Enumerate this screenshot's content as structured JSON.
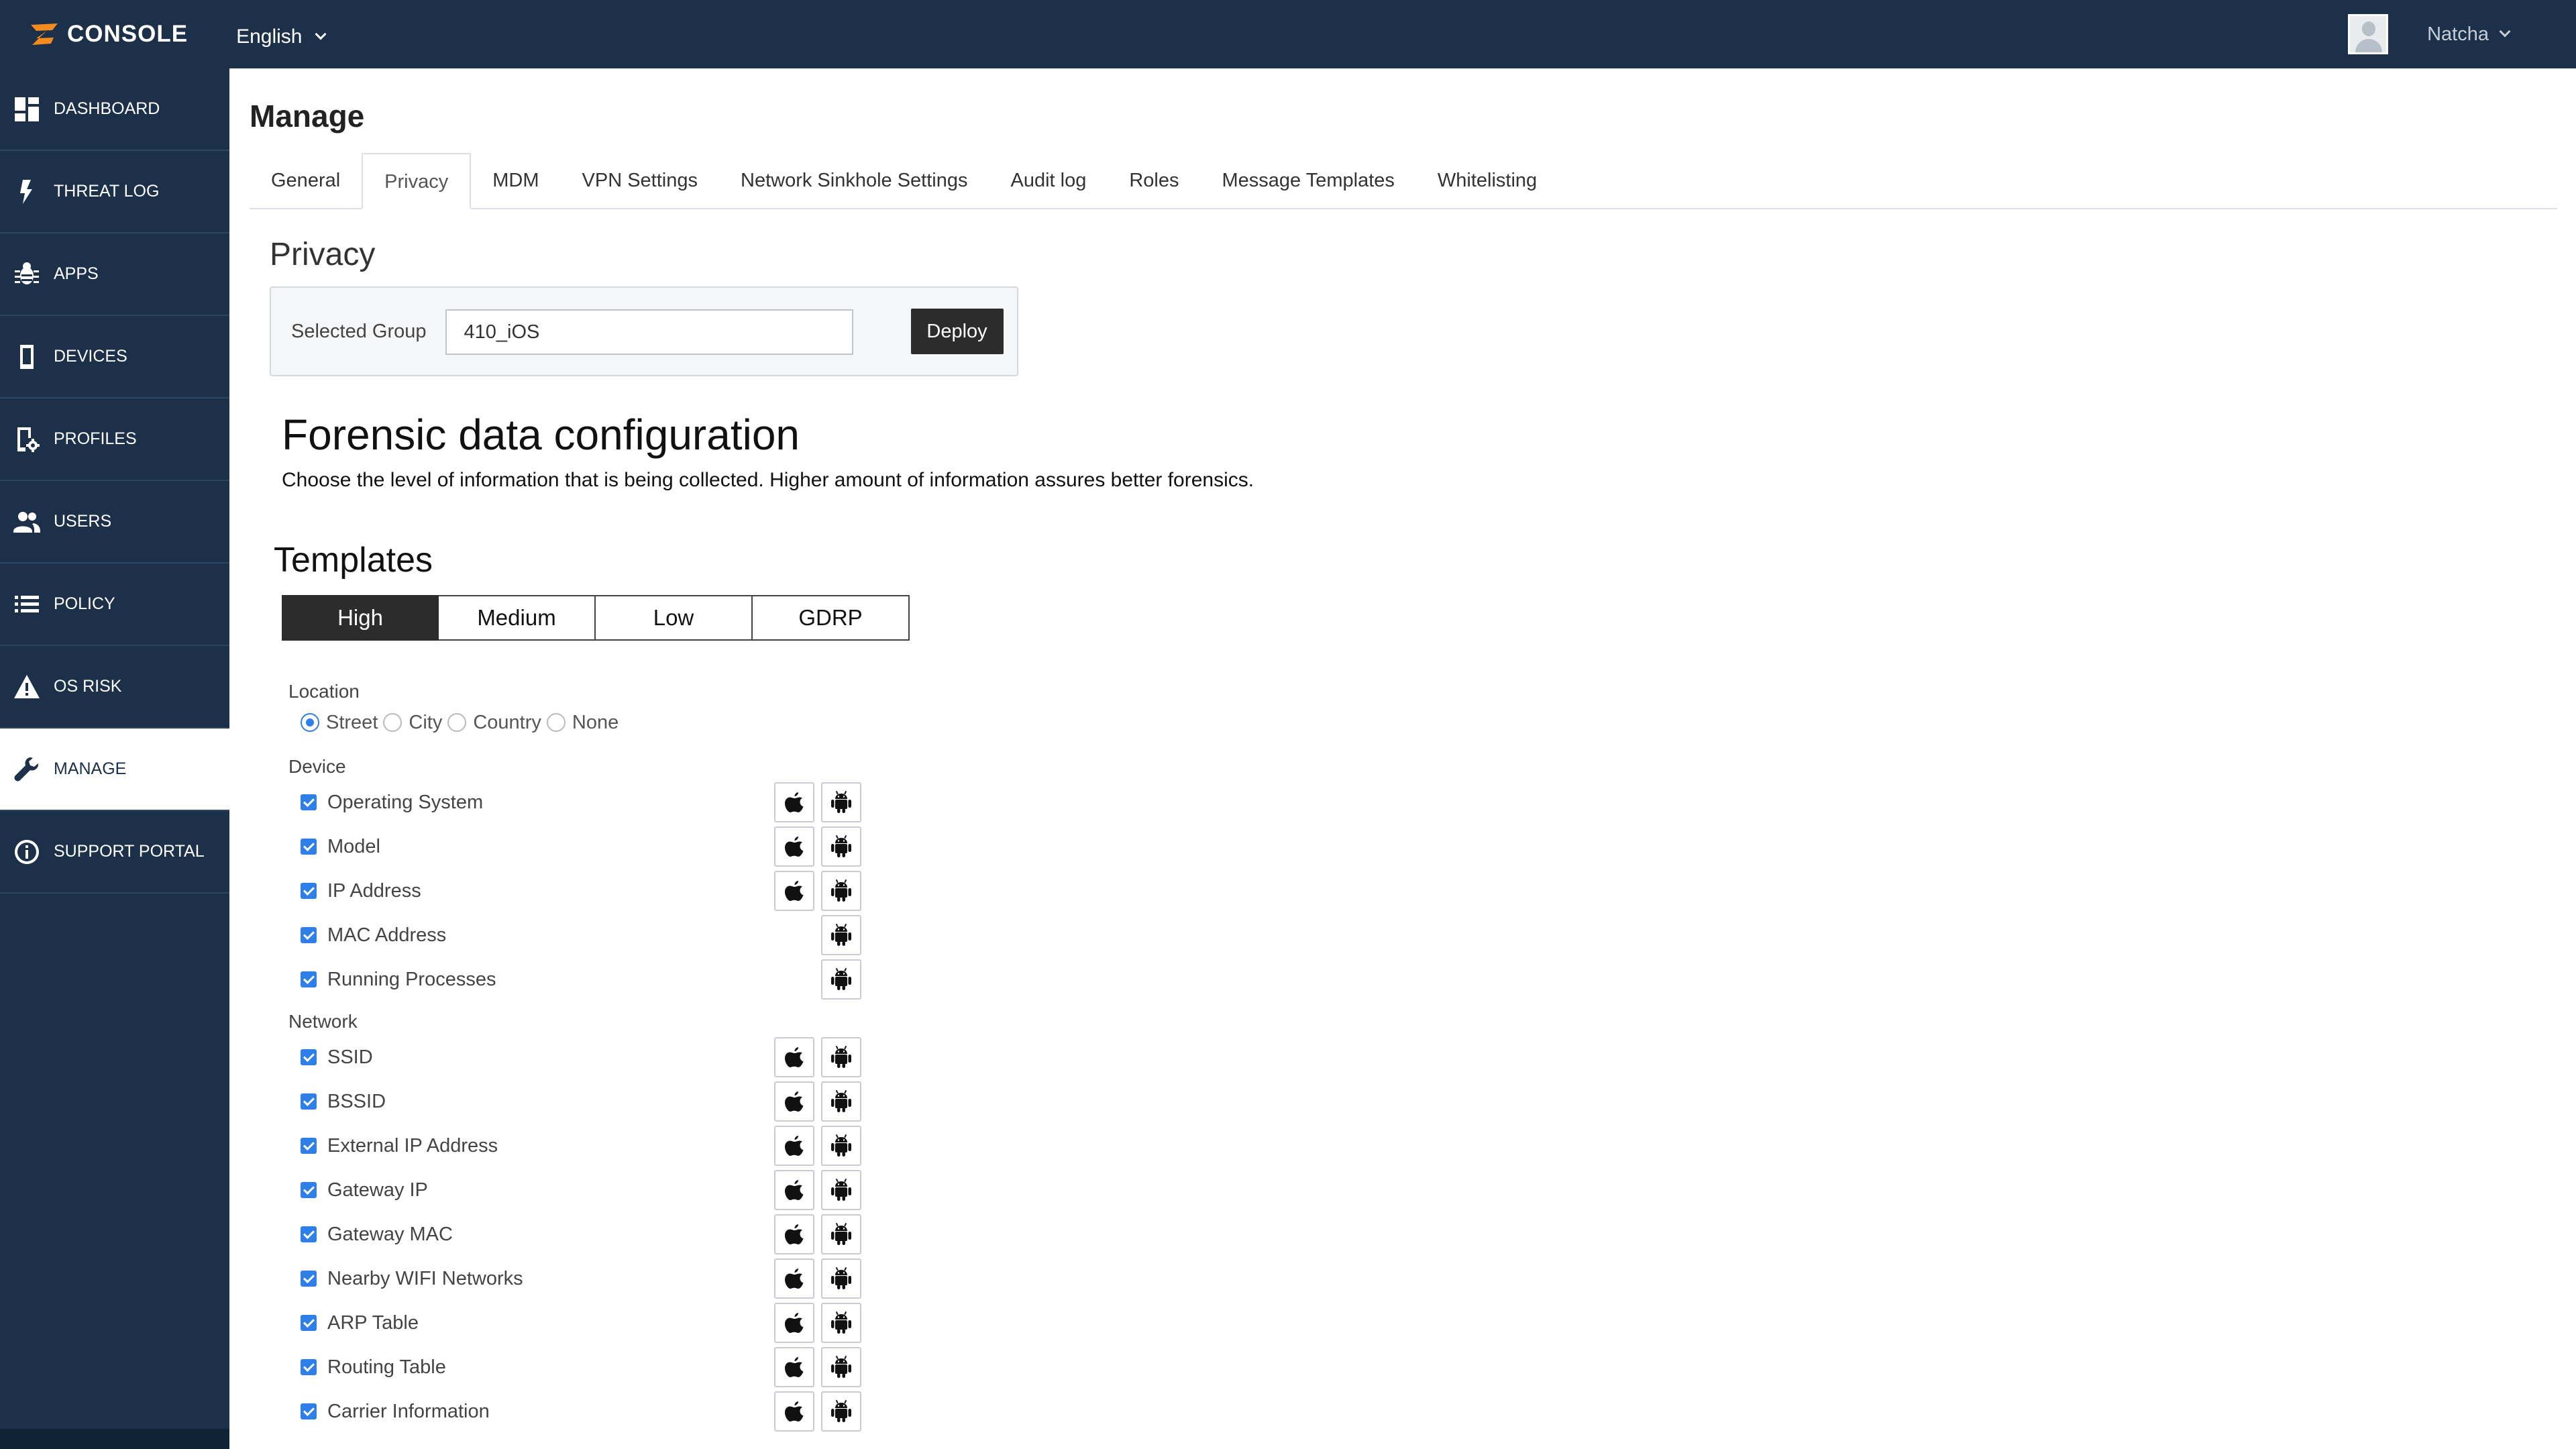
{
  "topbar": {
    "logo_text": "CONSOLE",
    "language": "English",
    "username": "Natcha"
  },
  "sidebar": {
    "items": [
      {
        "label": "DASHBOARD",
        "icon": "dashboard-icon"
      },
      {
        "label": "THREAT LOG",
        "icon": "lightning-icon"
      },
      {
        "label": "APPS",
        "icon": "bug-icon"
      },
      {
        "label": "DEVICES",
        "icon": "phone-icon"
      },
      {
        "label": "PROFILES",
        "icon": "profile-gear-icon"
      },
      {
        "label": "USERS",
        "icon": "users-icon"
      },
      {
        "label": "POLICY",
        "icon": "list-icon"
      },
      {
        "label": "OS RISK",
        "icon": "warning-icon"
      },
      {
        "label": "MANAGE",
        "icon": "wrench-icon",
        "active": true
      },
      {
        "label": "SUPPORT PORTAL",
        "icon": "info-icon"
      }
    ]
  },
  "main": {
    "title": "Manage",
    "tabs": [
      "General",
      "Privacy",
      "MDM",
      "VPN Settings",
      "Network Sinkhole Settings",
      "Audit log",
      "Roles",
      "Message Templates",
      "Whitelisting"
    ],
    "active_tab": "Privacy"
  },
  "privacy": {
    "title": "Privacy",
    "group_label": "Selected Group",
    "group_value": "410_iOS",
    "deploy_label": "Deploy"
  },
  "forensic": {
    "title": "Forensic data configuration",
    "description": "Choose the level of information that is being collected. Higher amount of information assures better forensics."
  },
  "templates": {
    "title": "Templates",
    "options": [
      "High",
      "Medium",
      "Low",
      "GDRP"
    ],
    "active": "High"
  },
  "location": {
    "label": "Location",
    "options": [
      "Street",
      "City",
      "Country",
      "None"
    ],
    "selected": "Street"
  },
  "device": {
    "label": "Device",
    "items": [
      {
        "label": "Operating System",
        "ios": true,
        "android": true
      },
      {
        "label": "Model",
        "ios": true,
        "android": true
      },
      {
        "label": "IP Address",
        "ios": true,
        "android": true
      },
      {
        "label": "MAC Address",
        "ios": false,
        "android": true
      },
      {
        "label": "Running Processes",
        "ios": false,
        "android": true
      }
    ]
  },
  "network": {
    "label": "Network",
    "items": [
      {
        "label": "SSID",
        "ios": true,
        "android": true
      },
      {
        "label": "BSSID",
        "ios": true,
        "android": true
      },
      {
        "label": "External IP Address",
        "ios": true,
        "android": true
      },
      {
        "label": "Gateway IP",
        "ios": true,
        "android": true
      },
      {
        "label": "Gateway MAC",
        "ios": true,
        "android": true
      },
      {
        "label": "Nearby WIFI Networks",
        "ios": true,
        "android": true
      },
      {
        "label": "ARP Table",
        "ios": true,
        "android": true
      },
      {
        "label": "Routing Table",
        "ios": true,
        "android": true
      },
      {
        "label": "Carrier Information",
        "ios": true,
        "android": true
      }
    ]
  },
  "colors": {
    "nav_bg": "#1c3049",
    "accent_blue": "#2f7fe8",
    "dark_button": "#2c2c2c"
  }
}
